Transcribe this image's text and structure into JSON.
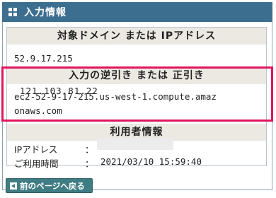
{
  "header": {
    "title": "入力情報",
    "icon": "grid-icon"
  },
  "domain_section": {
    "heading": "対象ドメイン または IPアドレス",
    "value": "52.9.17.215"
  },
  "lookup_section": {
    "heading": "入力の逆引き または 正引き",
    "overlay_ip": "121.103.81.22",
    "value_line1": "ec2-52-9-17-215.us-west-1.compute.amaz",
    "value_line2": "onaws.com"
  },
  "user_section": {
    "heading": "利用者情報",
    "ip_label": "IPアドレス",
    "sep": "：",
    "time_label": "ご利用時間",
    "time_value": "2021/03/10 15:59:40"
  },
  "back_button": {
    "label": "前のページへ戻る"
  },
  "colors": {
    "header": "#3c6e90",
    "highlight": "#e0155d",
    "button": "#3f7c83"
  }
}
